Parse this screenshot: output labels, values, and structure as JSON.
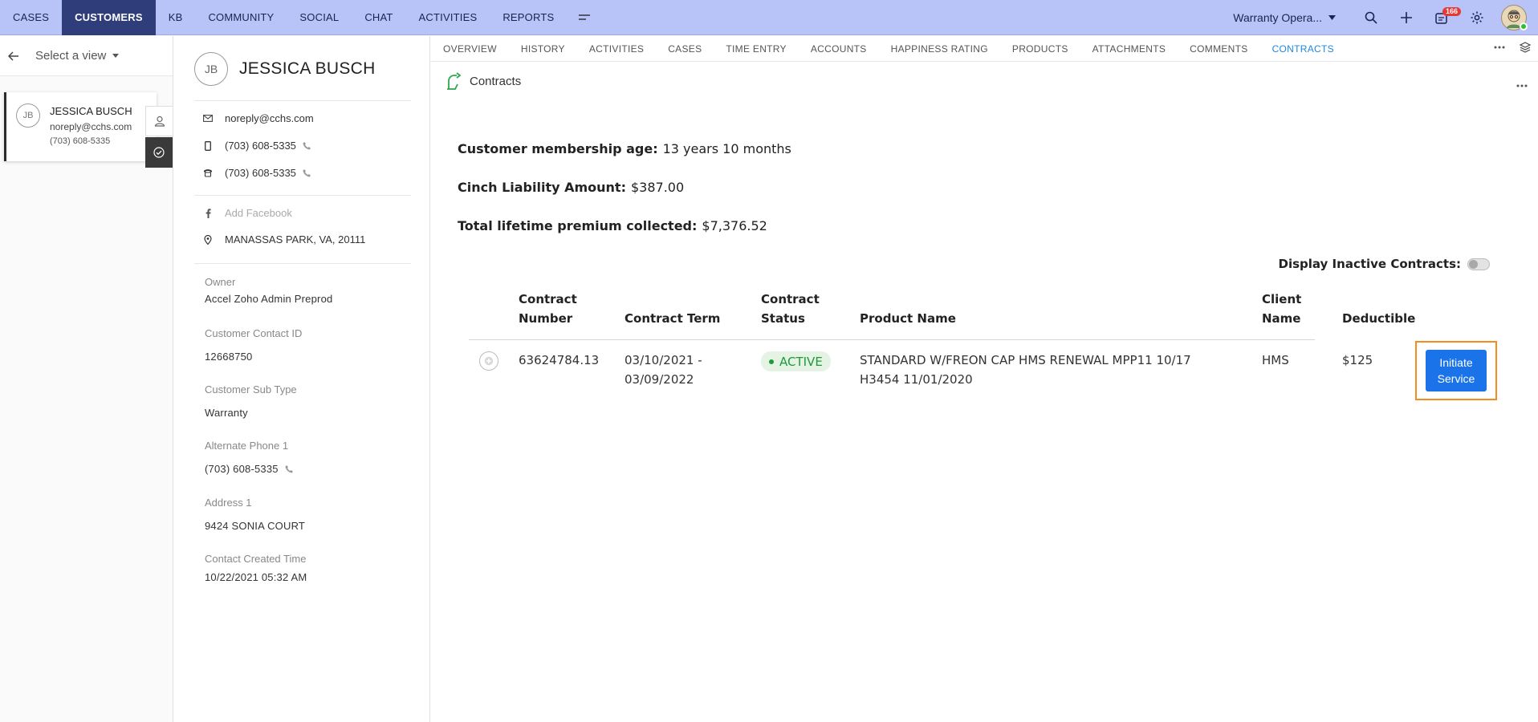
{
  "topnav": {
    "tabs": [
      "CASES",
      "CUSTOMERS",
      "KB",
      "COMMUNITY",
      "SOCIAL",
      "CHAT",
      "ACTIVITIES",
      "REPORTS"
    ],
    "department": "Warranty Opera...",
    "notification_count": "166"
  },
  "left": {
    "view_selector": "Select a view",
    "card": {
      "initials": "JB",
      "name": "JESSICA BUSCH",
      "email": "noreply@cchs.com",
      "phone": "(703) 608-5335"
    }
  },
  "contact": {
    "initials": "JB",
    "name": "JESSICA BUSCH",
    "email": "noreply@cchs.com",
    "mobile": "(703) 608-5335",
    "phone": "(703) 608-5335",
    "facebook_placeholder": "Add Facebook",
    "location": "MANASSAS PARK, VA, 20111",
    "fields": {
      "owner_label": "Owner",
      "owner_value": "Accel Zoho Admin Preprod",
      "contact_id_label": "Customer Contact ID",
      "contact_id_value": "12668750",
      "sub_type_label": "Customer Sub Type",
      "sub_type_value": "Warranty",
      "alt_phone_label": "Alternate Phone 1",
      "alt_phone_value": "(703) 608-5335",
      "address_label": "Address 1",
      "address_value": "9424 SONIA COURT",
      "created_label": "Contact Created Time",
      "created_value": "10/22/2021 05:32 AM"
    }
  },
  "subnav": {
    "tabs": [
      "OVERVIEW",
      "HISTORY",
      "ACTIVITIES",
      "CASES",
      "TIME ENTRY",
      "ACCOUNTS",
      "HAPPINESS RATING",
      "PRODUCTS",
      "ATTACHMENTS",
      "COMMENTS",
      "CONTRACTS"
    ],
    "active": "CONTRACTS"
  },
  "contracts": {
    "module_title": "Contracts",
    "membership_label": "Customer membership age:",
    "membership_value": "13 years 10 months",
    "liability_label": "Cinch Liability Amount:",
    "liability_value": "$387.00",
    "premium_label": "Total lifetime premium collected:",
    "premium_value": "$7,376.52",
    "inactive_label": "Display Inactive Contracts:",
    "inactive_enabled": false,
    "columns": {
      "number": [
        "Contract",
        "Number"
      ],
      "term": "Contract Term",
      "status": [
        "Contract",
        "Status"
      ],
      "product": "Product Name",
      "client": [
        "Client",
        "Name"
      ],
      "deductible": "Deductible"
    },
    "rows": [
      {
        "number": "63624784.13",
        "term": [
          "03/10/2021 -",
          "03/09/2022"
        ],
        "status": "ACTIVE",
        "product": [
          "STANDARD W/FREON CAP HMS RENEWAL MPP11 10/17",
          "H3454 11/01/2020"
        ],
        "client": "HMS",
        "deductible": "$125",
        "action": [
          "Initiate",
          "Service"
        ]
      }
    ]
  },
  "colors": {
    "topbar": "#b8c3f7",
    "active_tab": "#2f3d7a",
    "link": "#1e88e5",
    "status_bg": "#e4f3e4",
    "status_fg": "#1f9a3a",
    "button": "#1a73e8",
    "highlight": "#f68c1e"
  }
}
